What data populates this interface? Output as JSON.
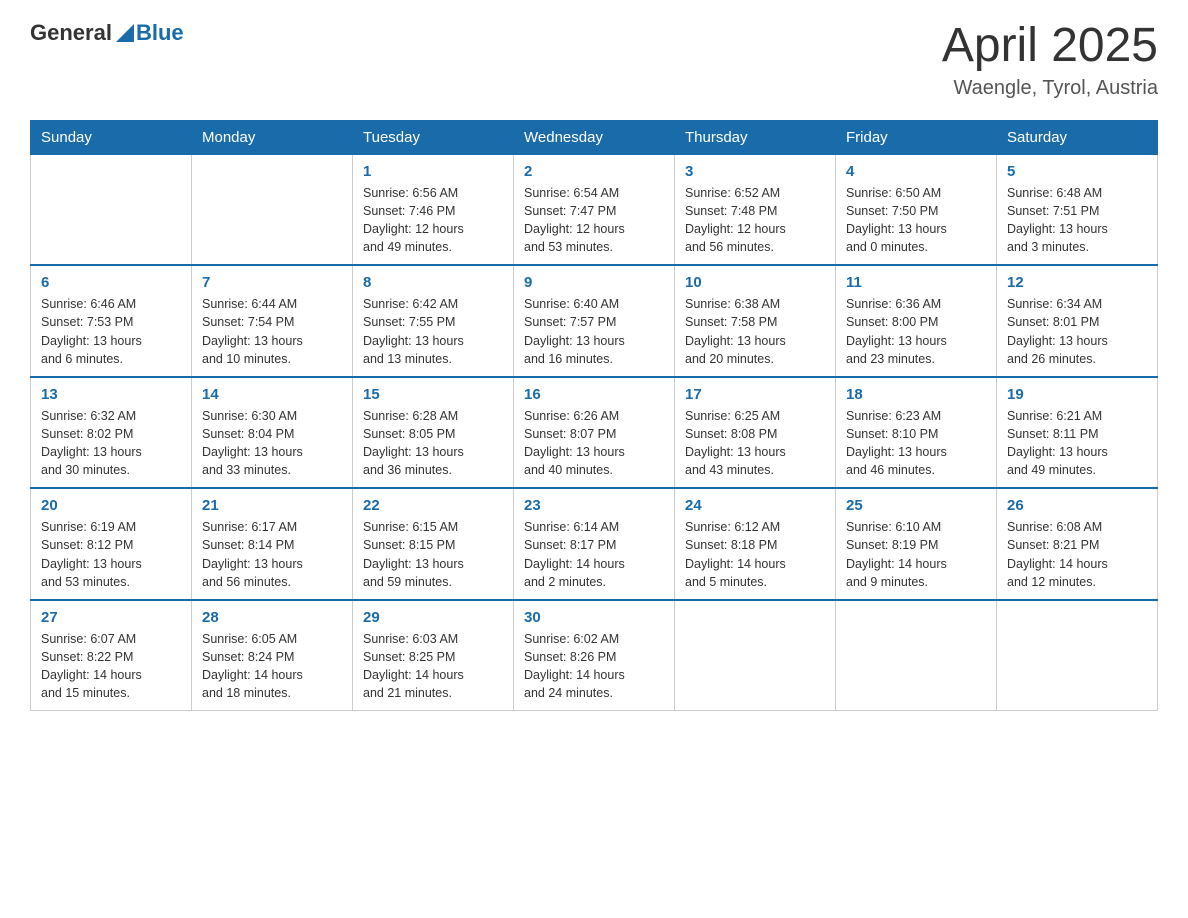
{
  "header": {
    "logo_general": "General",
    "logo_blue": "Blue",
    "title": "April 2025",
    "subtitle": "Waengle, Tyrol, Austria"
  },
  "weekdays": [
    "Sunday",
    "Monday",
    "Tuesday",
    "Wednesday",
    "Thursday",
    "Friday",
    "Saturday"
  ],
  "weeks": [
    [
      {
        "day": "",
        "info": ""
      },
      {
        "day": "",
        "info": ""
      },
      {
        "day": "1",
        "info": "Sunrise: 6:56 AM\nSunset: 7:46 PM\nDaylight: 12 hours\nand 49 minutes."
      },
      {
        "day": "2",
        "info": "Sunrise: 6:54 AM\nSunset: 7:47 PM\nDaylight: 12 hours\nand 53 minutes."
      },
      {
        "day": "3",
        "info": "Sunrise: 6:52 AM\nSunset: 7:48 PM\nDaylight: 12 hours\nand 56 minutes."
      },
      {
        "day": "4",
        "info": "Sunrise: 6:50 AM\nSunset: 7:50 PM\nDaylight: 13 hours\nand 0 minutes."
      },
      {
        "day": "5",
        "info": "Sunrise: 6:48 AM\nSunset: 7:51 PM\nDaylight: 13 hours\nand 3 minutes."
      }
    ],
    [
      {
        "day": "6",
        "info": "Sunrise: 6:46 AM\nSunset: 7:53 PM\nDaylight: 13 hours\nand 6 minutes."
      },
      {
        "day": "7",
        "info": "Sunrise: 6:44 AM\nSunset: 7:54 PM\nDaylight: 13 hours\nand 10 minutes."
      },
      {
        "day": "8",
        "info": "Sunrise: 6:42 AM\nSunset: 7:55 PM\nDaylight: 13 hours\nand 13 minutes."
      },
      {
        "day": "9",
        "info": "Sunrise: 6:40 AM\nSunset: 7:57 PM\nDaylight: 13 hours\nand 16 minutes."
      },
      {
        "day": "10",
        "info": "Sunrise: 6:38 AM\nSunset: 7:58 PM\nDaylight: 13 hours\nand 20 minutes."
      },
      {
        "day": "11",
        "info": "Sunrise: 6:36 AM\nSunset: 8:00 PM\nDaylight: 13 hours\nand 23 minutes."
      },
      {
        "day": "12",
        "info": "Sunrise: 6:34 AM\nSunset: 8:01 PM\nDaylight: 13 hours\nand 26 minutes."
      }
    ],
    [
      {
        "day": "13",
        "info": "Sunrise: 6:32 AM\nSunset: 8:02 PM\nDaylight: 13 hours\nand 30 minutes."
      },
      {
        "day": "14",
        "info": "Sunrise: 6:30 AM\nSunset: 8:04 PM\nDaylight: 13 hours\nand 33 minutes."
      },
      {
        "day": "15",
        "info": "Sunrise: 6:28 AM\nSunset: 8:05 PM\nDaylight: 13 hours\nand 36 minutes."
      },
      {
        "day": "16",
        "info": "Sunrise: 6:26 AM\nSunset: 8:07 PM\nDaylight: 13 hours\nand 40 minutes."
      },
      {
        "day": "17",
        "info": "Sunrise: 6:25 AM\nSunset: 8:08 PM\nDaylight: 13 hours\nand 43 minutes."
      },
      {
        "day": "18",
        "info": "Sunrise: 6:23 AM\nSunset: 8:10 PM\nDaylight: 13 hours\nand 46 minutes."
      },
      {
        "day": "19",
        "info": "Sunrise: 6:21 AM\nSunset: 8:11 PM\nDaylight: 13 hours\nand 49 minutes."
      }
    ],
    [
      {
        "day": "20",
        "info": "Sunrise: 6:19 AM\nSunset: 8:12 PM\nDaylight: 13 hours\nand 53 minutes."
      },
      {
        "day": "21",
        "info": "Sunrise: 6:17 AM\nSunset: 8:14 PM\nDaylight: 13 hours\nand 56 minutes."
      },
      {
        "day": "22",
        "info": "Sunrise: 6:15 AM\nSunset: 8:15 PM\nDaylight: 13 hours\nand 59 minutes."
      },
      {
        "day": "23",
        "info": "Sunrise: 6:14 AM\nSunset: 8:17 PM\nDaylight: 14 hours\nand 2 minutes."
      },
      {
        "day": "24",
        "info": "Sunrise: 6:12 AM\nSunset: 8:18 PM\nDaylight: 14 hours\nand 5 minutes."
      },
      {
        "day": "25",
        "info": "Sunrise: 6:10 AM\nSunset: 8:19 PM\nDaylight: 14 hours\nand 9 minutes."
      },
      {
        "day": "26",
        "info": "Sunrise: 6:08 AM\nSunset: 8:21 PM\nDaylight: 14 hours\nand 12 minutes."
      }
    ],
    [
      {
        "day": "27",
        "info": "Sunrise: 6:07 AM\nSunset: 8:22 PM\nDaylight: 14 hours\nand 15 minutes."
      },
      {
        "day": "28",
        "info": "Sunrise: 6:05 AM\nSunset: 8:24 PM\nDaylight: 14 hours\nand 18 minutes."
      },
      {
        "day": "29",
        "info": "Sunrise: 6:03 AM\nSunset: 8:25 PM\nDaylight: 14 hours\nand 21 minutes."
      },
      {
        "day": "30",
        "info": "Sunrise: 6:02 AM\nSunset: 8:26 PM\nDaylight: 14 hours\nand 24 minutes."
      },
      {
        "day": "",
        "info": ""
      },
      {
        "day": "",
        "info": ""
      },
      {
        "day": "",
        "info": ""
      }
    ]
  ]
}
